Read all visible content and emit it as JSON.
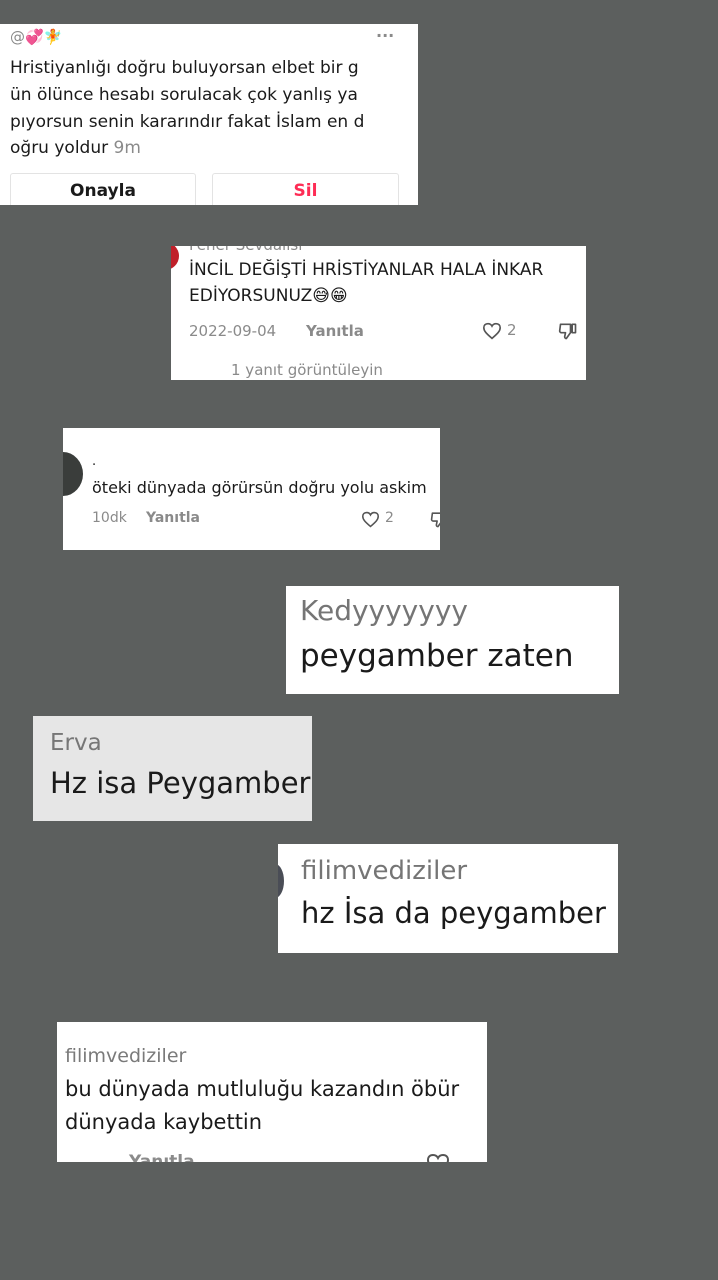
{
  "card1": {
    "handle": "@💞🧚",
    "more_label": "···",
    "lines": [
      "Hristiyanlığı doğru buluyorsan elbet bir g",
      "ün ölünce hesabı sorulacak çok yanlış ya",
      "pıyorsun senin kararındır fakat İslam en d",
      "oğru yoldur"
    ],
    "time": "9m",
    "approve_label": "Onayla",
    "delete_label": "Sil"
  },
  "card2": {
    "username": "Fener Sevdalısı",
    "lines": [
      "İNCİL DEĞİŞTİ HRİSTİYANLAR HALA İNKAR",
      "EDİYORSUNUZ😅😁"
    ],
    "date": "2022-09-04",
    "reply_label": "Yanıtla",
    "likes": "2",
    "view_replies": "1 yanıt görüntüleyin"
  },
  "card3": {
    "username": ".",
    "text": "öteki dünyada görürsün doğru yolu askim",
    "time": "10dk",
    "reply_label": "Yanıtla",
    "likes": "2"
  },
  "card4": {
    "username": "Kedyyyyyyy",
    "text": "peygamber zaten"
  },
  "card5": {
    "username": "Erva",
    "text": "Hz isa Peygamber"
  },
  "card6": {
    "username": "filimvediziler",
    "text": "hz İsa da peygamber"
  },
  "card7": {
    "username": "filimvediziler",
    "lines": [
      "bu dünyada mutluluğu kazandın öbür",
      "dünyada kaybettin"
    ],
    "reply_label": "Yanıtla"
  },
  "colors": {
    "background": "#5c5f5e",
    "delete_red": "#fe2c55",
    "muted": "#8a8a8a"
  }
}
